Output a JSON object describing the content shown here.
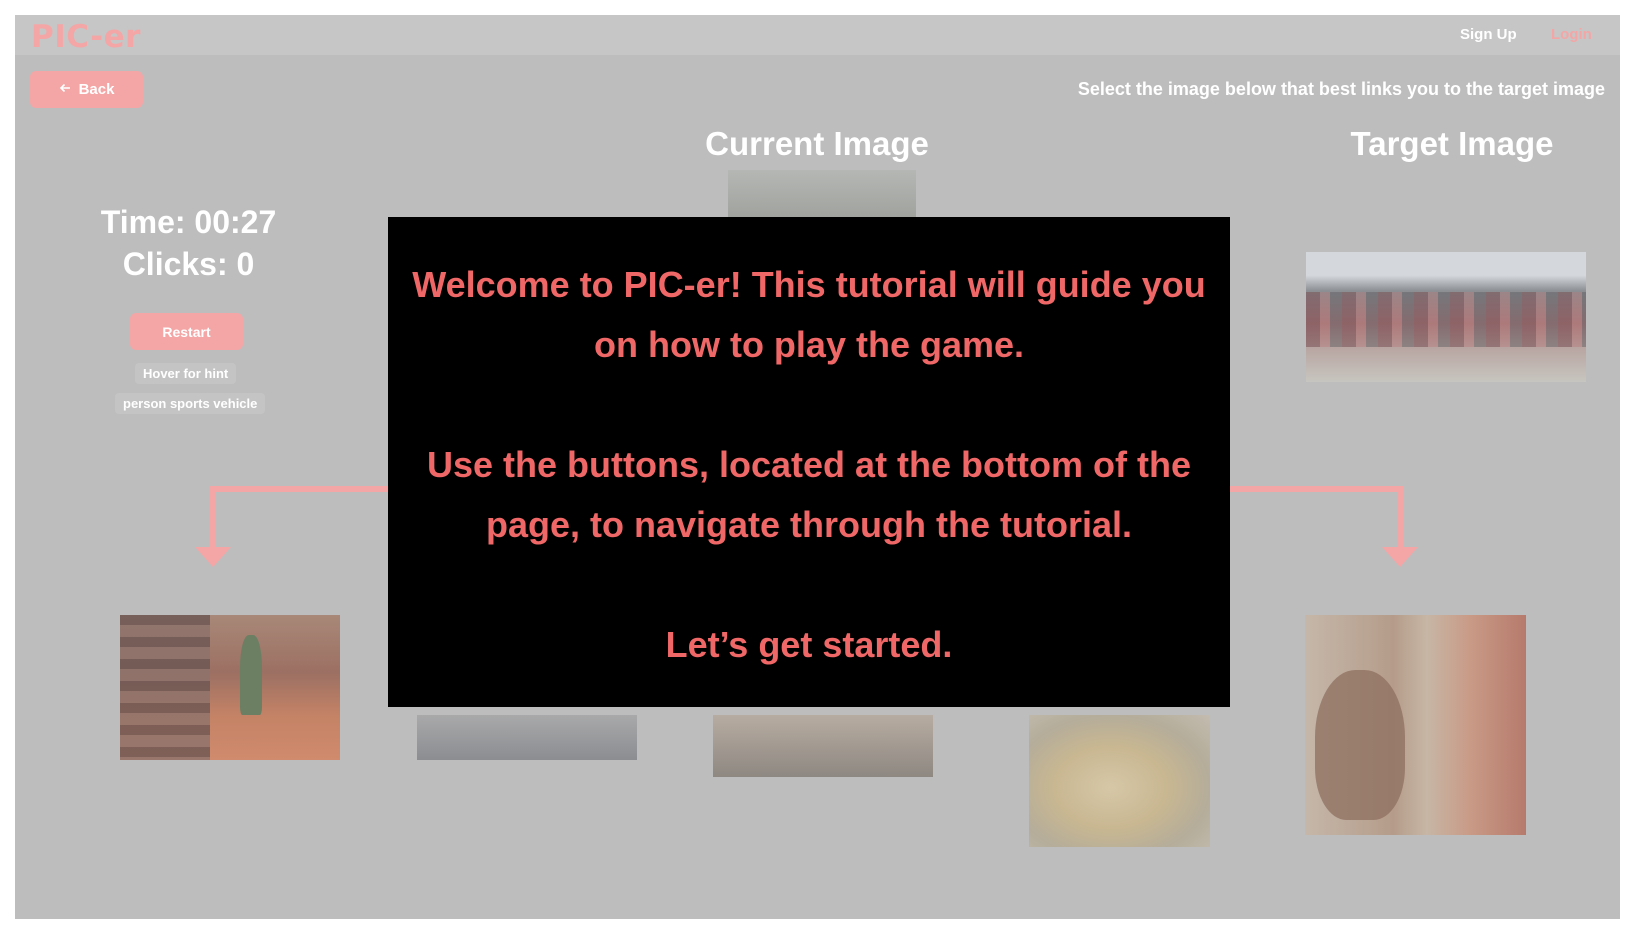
{
  "app": {
    "brand": "PIC-er",
    "nav": {
      "signup": "Sign Up",
      "login": "Login"
    }
  },
  "toolbar": {
    "back_label": "Back",
    "instruction": "Select the image below that best links you to the target image"
  },
  "headings": {
    "current": "Current Image",
    "target": "Target Image"
  },
  "game": {
    "time_text": "Time: 00:27",
    "clicks_text": "Clicks: 0",
    "restart_label": "Restart",
    "hint_label": "Hover for hint",
    "hint_text": "person sports vehicle"
  },
  "modal": {
    "line1": "Welcome to PIC-er! This tutorial will guide you on how to play the game.",
    "line2": "Use the buttons, located at the bottom of the page, to navigate through the tutorial.",
    "line3": "Let’s get started."
  },
  "colors": {
    "accent": "#f4a6a6",
    "modal_text": "#f06767",
    "overlay_bg": "#bdbdbd",
    "modal_bg": "#000000"
  },
  "icons": {
    "back": "arrow-left-icon"
  }
}
